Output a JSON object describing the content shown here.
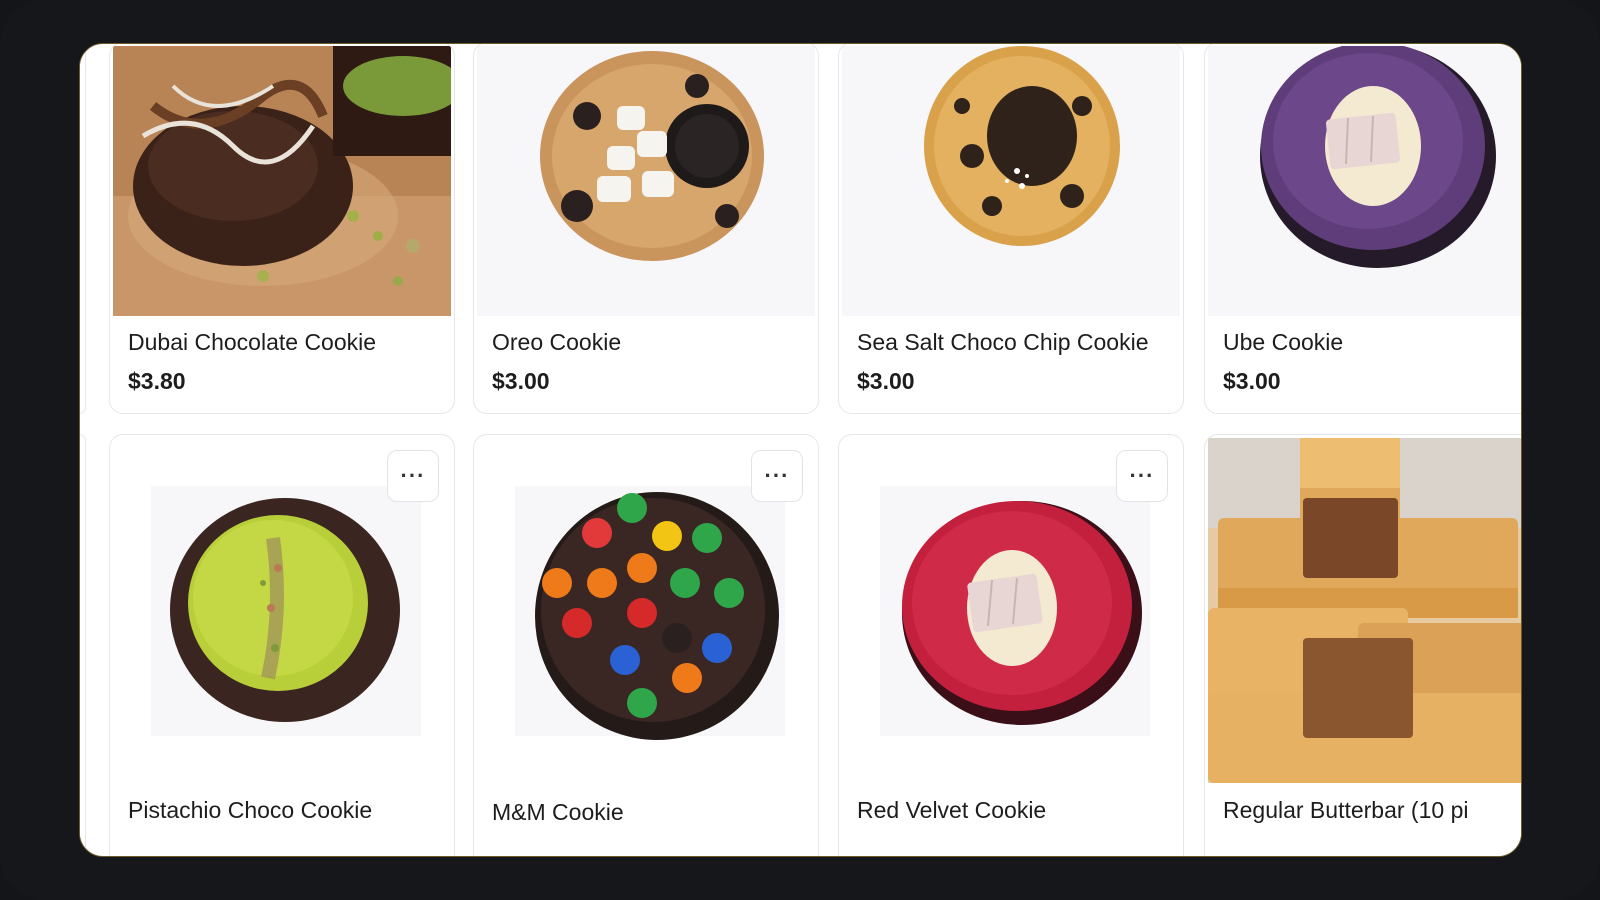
{
  "products": [
    {
      "name": "Dubai Chocolate Cookie",
      "price": "$3.80",
      "image_icon": "dubai-chocolate-cookie-photo"
    },
    {
      "name": "Oreo Cookie",
      "price": "$3.00",
      "image_icon": "oreo-cookie-photo"
    },
    {
      "name": "Sea Salt Choco Chip Cookie",
      "price": "$3.00",
      "image_icon": "sea-salt-choco-chip-cookie-photo"
    },
    {
      "name": "Ube Cookie",
      "price": "$3.00",
      "image_icon": "ube-cookie-photo"
    },
    {
      "name": "Pistachio Choco Cookie",
      "price": "",
      "image_icon": "pistachio-choco-cookie-photo"
    },
    {
      "name": "M&M Cookie",
      "price": "",
      "image_icon": "mm-cookie-photo"
    },
    {
      "name": "Red Velvet Cookie",
      "price": "",
      "image_icon": "red-velvet-cookie-photo"
    },
    {
      "name": "Regular Butterbar (10 pi",
      "price": "",
      "image_icon": "butterbar-photo"
    }
  ],
  "more_button": {
    "label": "···",
    "icon": "more-horizontal-icon"
  },
  "colors": {
    "text": "#1d1d1f",
    "card_border": "#e6e6ea",
    "frame": "#16171b"
  }
}
